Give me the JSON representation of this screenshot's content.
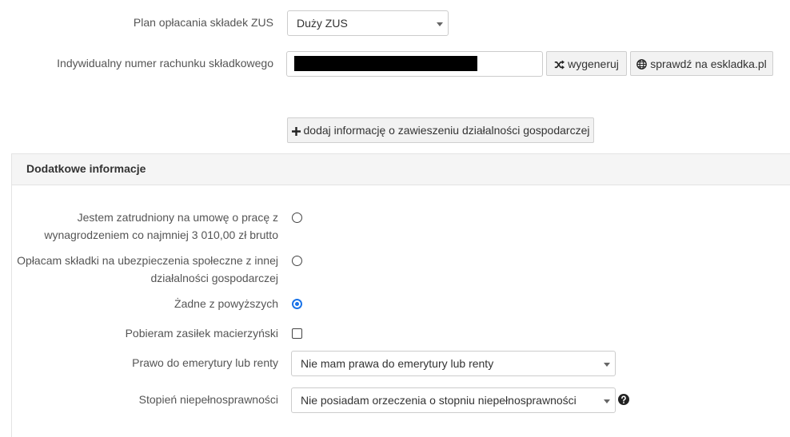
{
  "zus_plan": {
    "label": "Plan opłacania składek ZUS",
    "selected": "Duży ZUS"
  },
  "account": {
    "label": "Indywidualny numer rachunku składkowego",
    "value": "",
    "generate_label": "wygeneruj",
    "check_label": "sprawdź na eskladka.pl"
  },
  "suspension": {
    "add_label": "dodaj informację o zawieszeniu działalności gospodarczej"
  },
  "additional": {
    "title": "Dodatkowe informacje",
    "options": [
      {
        "label_line1": "Jestem zatrudniony na umowę o pracę z",
        "label_line2": "wynagrodzeniem co najmniej 3 010,00 zł brutto",
        "checked": false
      },
      {
        "label_line1": "Opłacam składki na ubezpieczenia społeczne z innej",
        "label_line2": "działalności gospodarczej",
        "checked": false
      },
      {
        "label_line1": "Żadne z powyższych",
        "checked": true
      }
    ],
    "maternity": {
      "label": "Pobieram zasiłek macierzyński",
      "checked": false
    },
    "pension": {
      "label": "Prawo do emerytury lub renty",
      "selected": "Nie mam prawa do emerytury lub renty"
    },
    "disability": {
      "label": "Stopień niepełnosprawności",
      "selected": "Nie posiadam orzeczenia o stopniu niepełnosprawności"
    }
  },
  "colors": {
    "accent": "#1a73e8",
    "panel_bg": "#f5f5f5",
    "button_bg": "#f2f2f2"
  }
}
